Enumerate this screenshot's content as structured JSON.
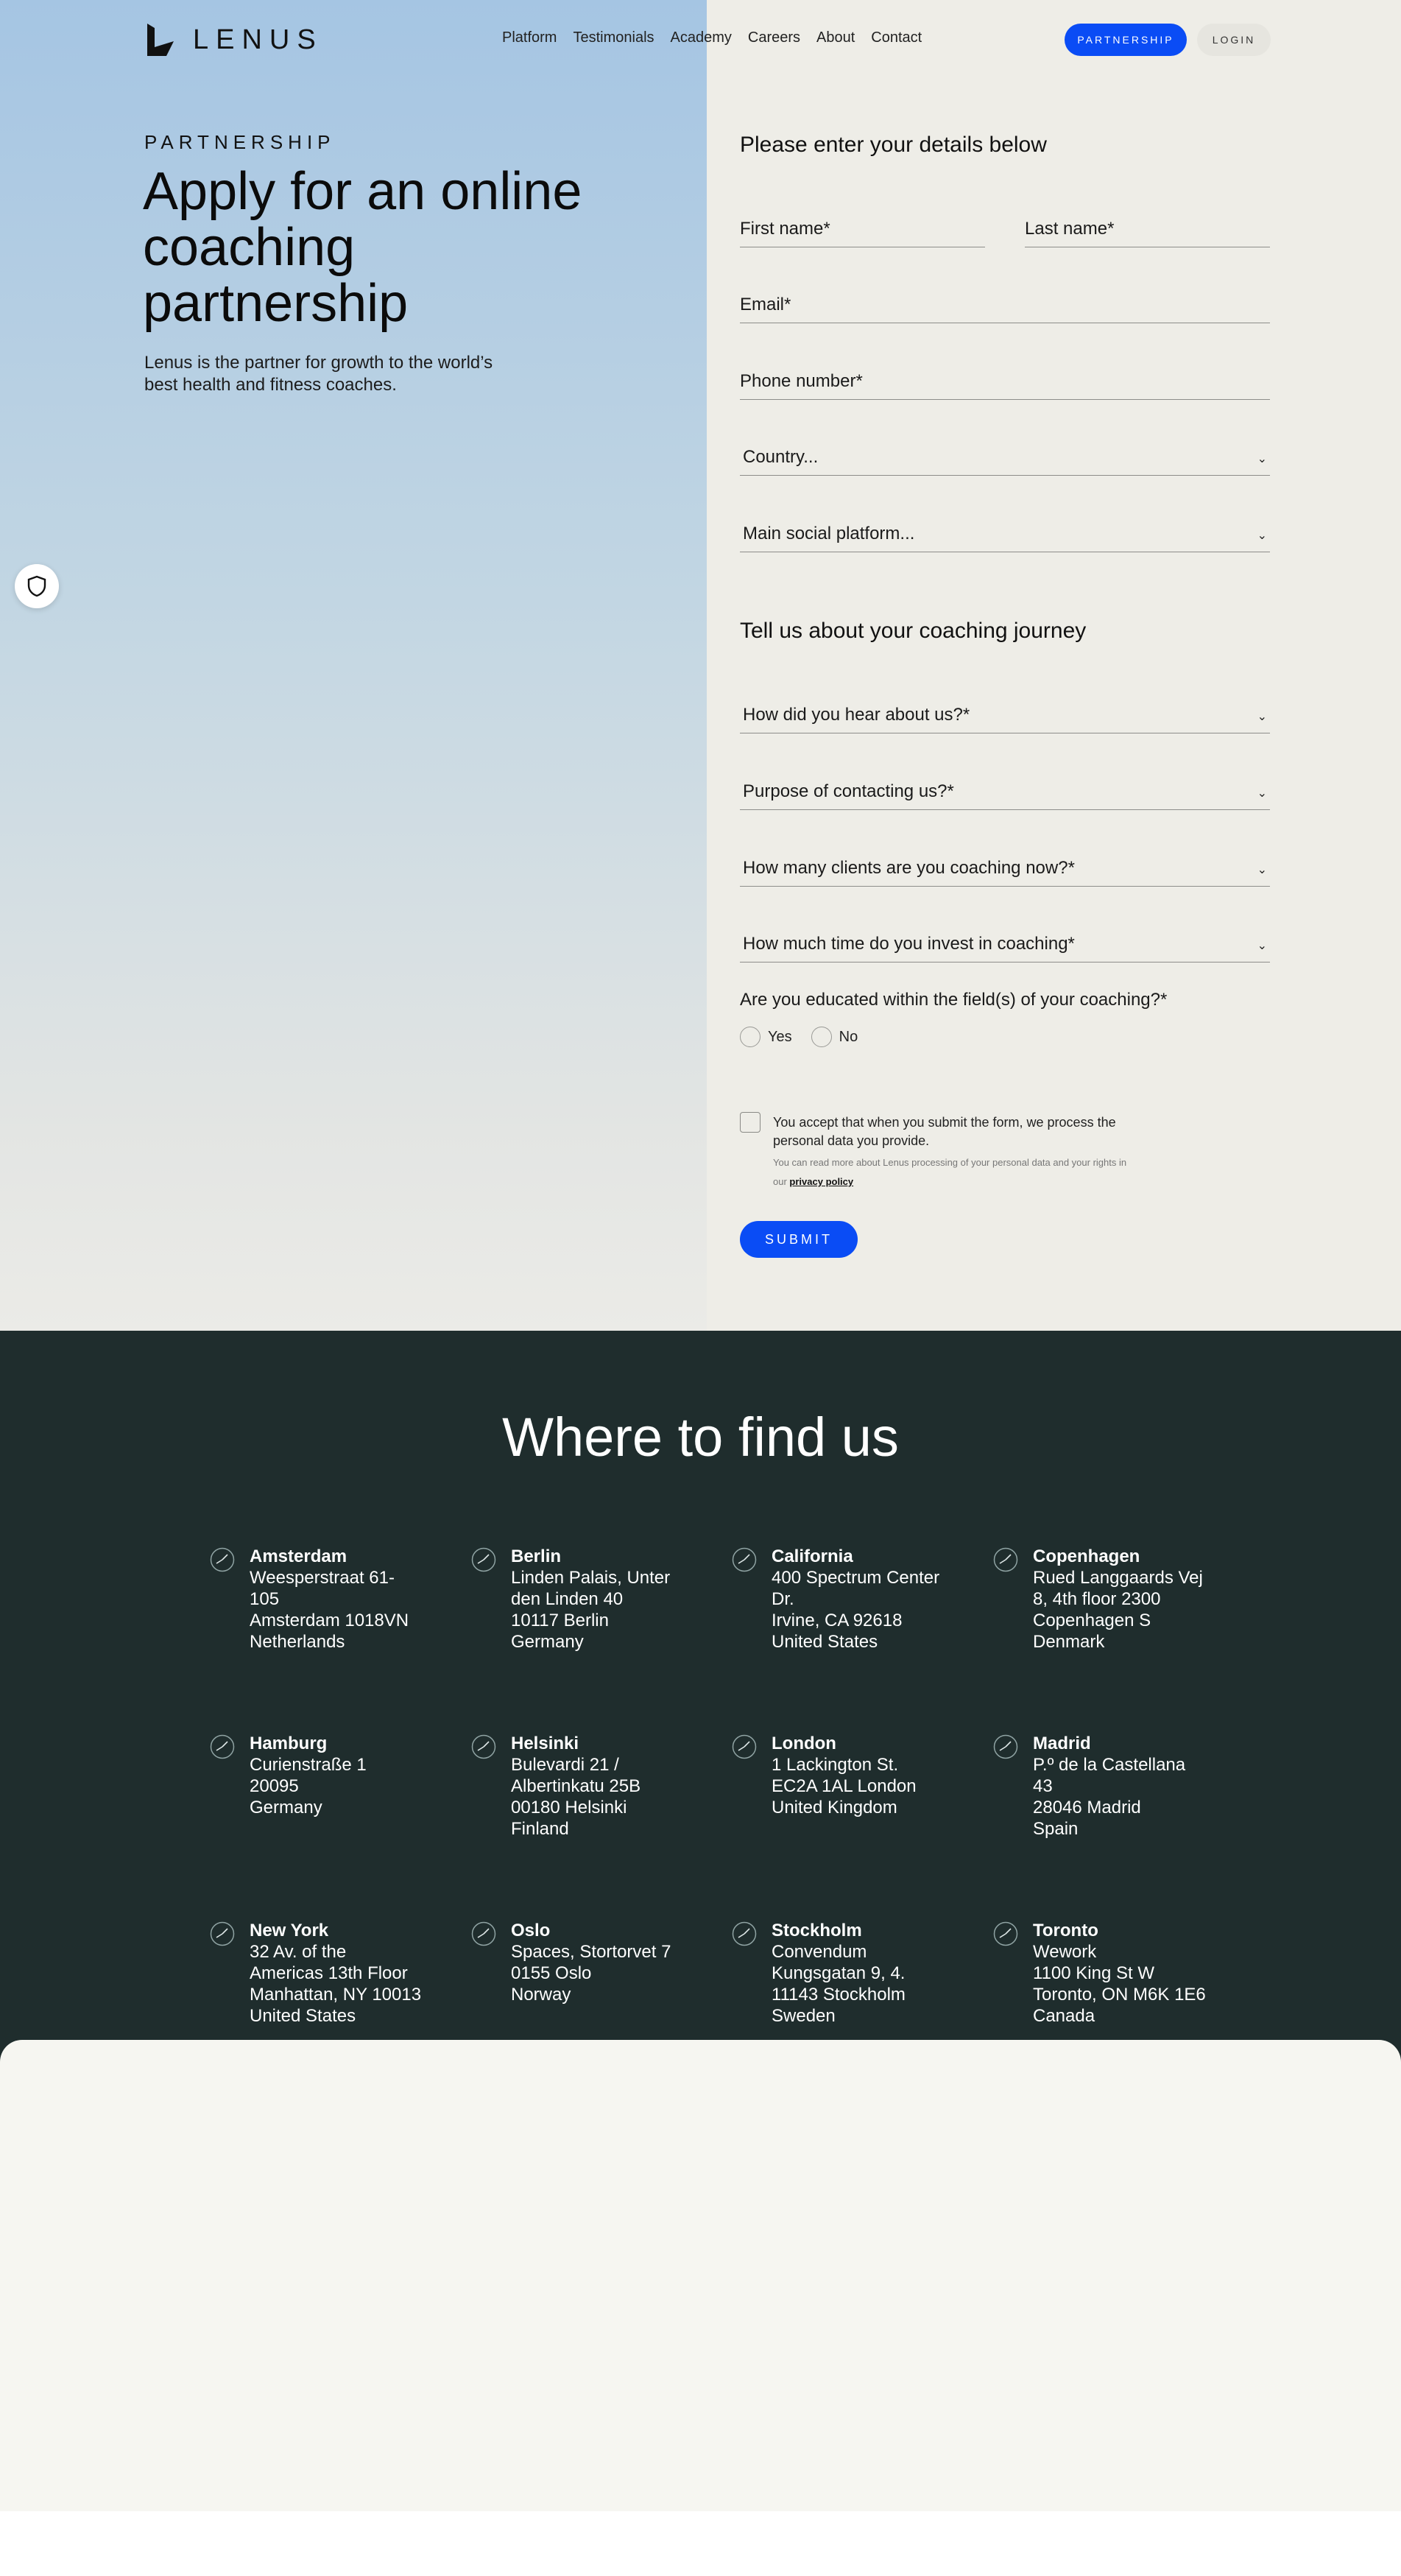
{
  "nav": {
    "logo_text": "LENUS",
    "links": [
      "Platform",
      "Testimonials",
      "Academy",
      "Careers",
      "About",
      "Contact"
    ],
    "partnership_button": "PARTNERSHIP",
    "login_button": "LOGIN",
    "accent_color": "#0a4cf5"
  },
  "hero": {
    "eyebrow": "PARTNERSHIP",
    "title": "Apply for an online coaching partnership",
    "subtitle": "Lenus is the partner for growth to the world’s best health and fitness coaches."
  },
  "form": {
    "heading": "Please enter your details below",
    "first_name": "First name*",
    "last_name": "Last name*",
    "email": "Email*",
    "phone": "Phone number*",
    "country": "Country...",
    "social": "Main social platform...",
    "journey_heading": "Tell us about your coaching journey",
    "hear_about": "How did you hear about us?*",
    "purpose": "Purpose of contacting us?*",
    "clients": "How many clients are you coaching now?*",
    "time_invest": "How much time do you invest in coaching*",
    "educated_question": "Are you educated within the field(s) of your coaching?*",
    "radio_yes": "Yes",
    "radio_no": "No",
    "consent_text": "You accept that when you submit the form, we process the personal data you provide.",
    "consent_small": "You can read more about Lenus processing of your personal data and your rights in our",
    "privacy_link": "privacy policy",
    "submit": "SUBMIT",
    "chevron": "⌄"
  },
  "locations": {
    "title": "Where to find us",
    "offices": [
      {
        "city": "Amsterdam",
        "lines": [
          "Weesperstraat 61-",
          "105",
          "Amsterdam 1018VN",
          "Netherlands"
        ]
      },
      {
        "city": "Berlin",
        "lines": [
          "Linden Palais, Unter",
          "den Linden 40",
          "10117 Berlin",
          "Germany"
        ]
      },
      {
        "city": "California",
        "lines": [
          "400 Spectrum Center",
          "Dr.",
          "Irvine, CA 92618",
          "United States"
        ]
      },
      {
        "city": "Copenhagen",
        "lines": [
          "Rued Langgaards Vej",
          "8, 4th floor 2300",
          "Copenhagen S",
          "Denmark"
        ]
      },
      {
        "city": "Hamburg",
        "lines": [
          "Curienstraße 1",
          "20095",
          "Germany"
        ]
      },
      {
        "city": "Helsinki",
        "lines": [
          "Bulevardi 21 /",
          "Albertinkatu 25B",
          "00180 Helsinki",
          "Finland"
        ]
      },
      {
        "city": "London",
        "lines": [
          "1 Lackington St.",
          "EC2A 1AL London",
          "United Kingdom"
        ]
      },
      {
        "city": "Madrid",
        "lines": [
          "P.º de la Castellana",
          "43",
          "28046 Madrid",
          "Spain"
        ]
      },
      {
        "city": "New York",
        "lines": [
          "32 Av. of the",
          "Americas 13th Floor",
          "Manhattan, NY 10013",
          "United States"
        ]
      },
      {
        "city": "Oslo",
        "lines": [
          "Spaces, Stortorvet 7",
          "0155 Oslo",
          "Norway"
        ]
      },
      {
        "city": "Stockholm",
        "lines": [
          "Convendum",
          "Kungsgatan 9, 4.",
          "11143 Stockholm",
          "Sweden"
        ]
      },
      {
        "city": "Toronto",
        "lines": [
          "Wework",
          "1100 King St W",
          "Toronto, ON M6K 1E6",
          "Canada"
        ]
      }
    ]
  }
}
